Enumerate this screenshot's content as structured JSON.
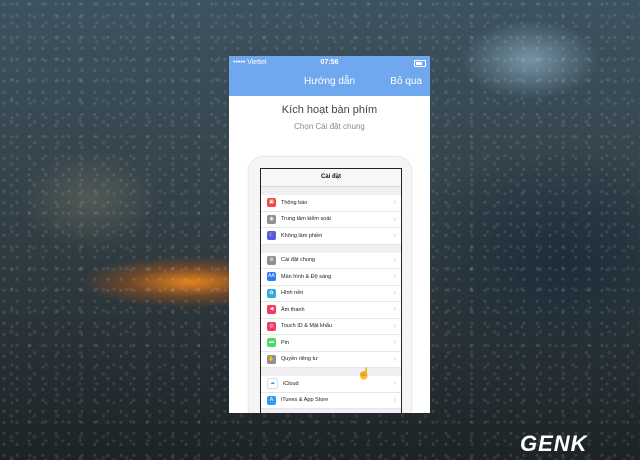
{
  "statusbar": {
    "carrier": "••••• Viettel",
    "time": "07:56"
  },
  "navbar": {
    "title": "Hướng dẫn",
    "skip_label": "Bỏ qua"
  },
  "heading": "Kích hoạt bàn phím",
  "subheading": "Chọn Cài đặt chung",
  "settings_screen": {
    "title": "Cài đặt",
    "group1": [
      {
        "label": "Thông báo",
        "icon": "notifications-icon",
        "color": "#f24b3f",
        "glyph": "▣"
      },
      {
        "label": "Trung tâm kiểm soát",
        "icon": "control-center-icon",
        "color": "#8e8e93",
        "glyph": "◉"
      },
      {
        "label": "Không làm phiền",
        "icon": "moon-icon",
        "color": "#5b5bd6",
        "glyph": "☾"
      }
    ],
    "group2": [
      {
        "label": "Cài đặt chung",
        "icon": "gear-icon",
        "color": "#8e8e93",
        "glyph": "⚙"
      },
      {
        "label": "Màn hình & Độ sáng",
        "icon": "display-icon",
        "color": "#2f7bf6",
        "glyph": "AA"
      },
      {
        "label": "Hình nền",
        "icon": "wallpaper-icon",
        "color": "#34aadc",
        "glyph": "✿"
      },
      {
        "label": "Âm thanh",
        "icon": "sound-icon",
        "color": "#f2395d",
        "glyph": "◀"
      },
      {
        "label": "Touch ID & Mật khẩu",
        "icon": "touch-id-icon",
        "color": "#f2395d",
        "glyph": "◎"
      },
      {
        "label": "Pin",
        "icon": "battery-icon",
        "color": "#4cd964",
        "glyph": "▬"
      },
      {
        "label": "Quyền riêng tư",
        "icon": "privacy-hand-icon",
        "color": "#8e8e93",
        "glyph": "✋"
      }
    ],
    "group3": [
      {
        "label": "iCloud",
        "icon": "icloud-icon",
        "color": "#ffffff",
        "glyph": "☁"
      },
      {
        "label": "iTunes & App Store",
        "icon": "app-store-icon",
        "color": "#2f9bf6",
        "glyph": "A"
      }
    ]
  },
  "watermark": "GENK",
  "colors": {
    "accent": "#6fa8ee"
  }
}
